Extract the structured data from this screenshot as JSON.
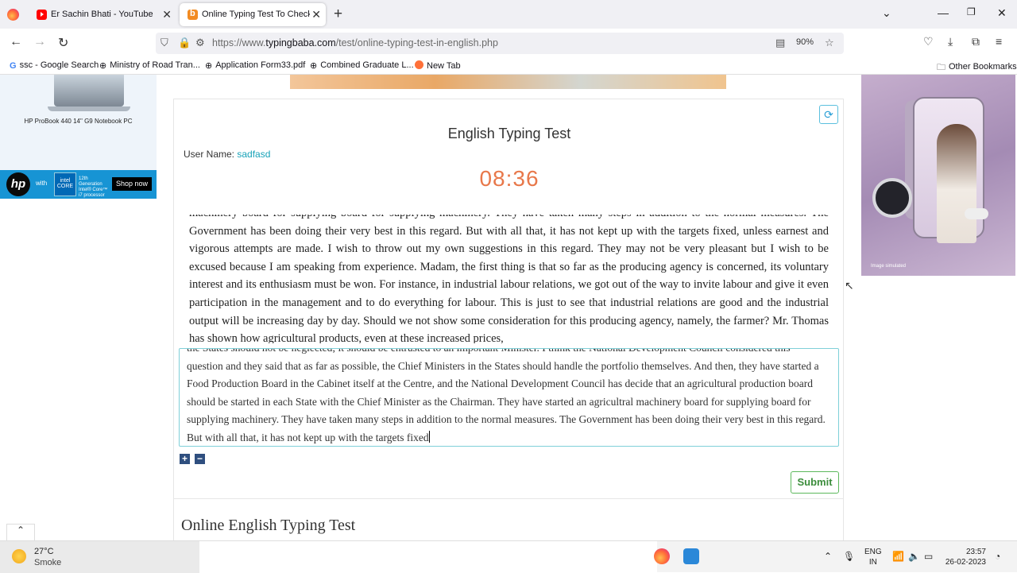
{
  "browser": {
    "tabs": [
      {
        "title": "Er Sachin Bhati - YouTube"
      },
      {
        "title": "Online Typing Test To Check Your Typing Speed"
      }
    ],
    "url_prefix": "https://www.",
    "url_domain": "typingbaba.com",
    "url_path": "/test/online-typing-test-in-english.php",
    "zoom": "90%",
    "bookmarks": [
      {
        "label": "ssc - Google Search",
        "icon": "google-icon"
      },
      {
        "label": "Ministry of Road Tran...",
        "icon": "globe-icon"
      },
      {
        "label": "Application Form33.pdf",
        "icon": "globe-icon"
      },
      {
        "label": "Combined Graduate L...",
        "icon": "globe-icon"
      },
      {
        "label": "New Tab",
        "icon": "firefox-icon"
      }
    ],
    "other_bookmarks": "Other Bookmarks"
  },
  "ads": {
    "left_caption": "HP ProBook 440 14\" G9 Notebook PC",
    "left_with": "with",
    "left_intel": "intel CORE",
    "left_gen": "12th Generation Intel® Core™ i7 processor",
    "left_cta": "Shop now",
    "right_note": "Image simulated"
  },
  "test": {
    "title": "English Typing Test",
    "user_label": "User Name:",
    "user_name": "sadfasd",
    "timer": "08:36",
    "passage": "machinery board for supplying board for supplying machinery. They have taken many steps in addition to the normal measures. The Government has been doing their very best in this regard. But with all that, it has not kept up with the targets fixed, unless earnest and vigorous attempts are made. I wish to throw out my own suggestions in this regard. They may not be very pleasant but I wish to be excused because I am speaking from experience. Madam, the first thing is that so far as the producing agency is concerned, its voluntary interest and its enthusiasm must be won. For instance, in industrial labour relations, we got out of the way to invite labour and give it even participation in the management and to do everything for labour. This is just to see that industrial relations are good and the industrial output will be increasing day by day. Should we not show some consideration for this producing agency, namely, the farmer? Mr. Thomas has shown how agricultural products, even at these increased prices,",
    "typed": "the States should not be neglected; it should be entrusted to an important Minister. I think the National Development Council considered this question and they said that as far as possible, the Chief Ministers in the States should handle the portfolio themselves. And then, they have started a Food Production Board in the Cabinet itself at the Centre, and the National Development Council has decide that an agricultural production board should be started in each State with the Chief Minister as the Chairman. They have started an agricultral machinery board for supplying board for supplying machinery. They have taken many steps in addition to the normal measures. The Government has been doing their very best in this regard. But with all that, it has not kept up with the targets fixed",
    "submit": "Submit",
    "zoom_in": "+",
    "zoom_out": "−"
  },
  "section_heading": "Online English Typing Test",
  "taskbar": {
    "temp": "27°C",
    "condition": "Smoke",
    "lang_top": "ENG",
    "lang_bottom": "IN",
    "time": "23:57",
    "date": "26-02-2023"
  }
}
